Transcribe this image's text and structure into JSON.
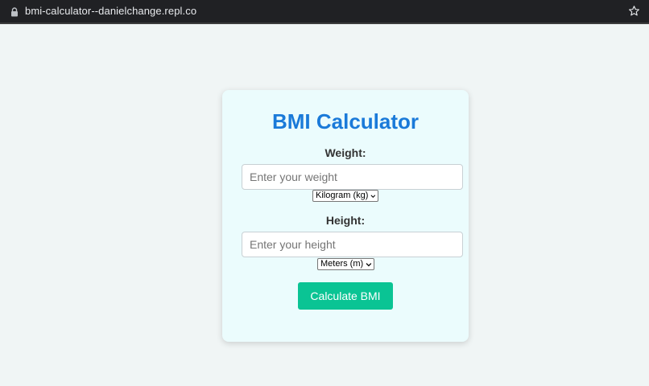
{
  "browser": {
    "url": "bmi-calculator--danielchange.repl.co"
  },
  "calculator": {
    "title": "BMI Calculator",
    "weight": {
      "label": "Weight:",
      "placeholder": "Enter your weight",
      "value": "",
      "unit_selected": "Kilogram (kg)"
    },
    "height": {
      "label": "Height:",
      "placeholder": "Enter your height",
      "value": "",
      "unit_selected": "Meters (m)"
    },
    "button_label": "Calculate BMI"
  },
  "colors": {
    "browser_bar": "#202124",
    "page_bg": "#f0f5f5",
    "card_bg": "#ebfcfd",
    "title": "#1a7ad9",
    "button": "#0ac494"
  },
  "icons": {
    "address_bar_lock": "lock-icon",
    "bookmark": "star-icon",
    "select_chevron": "chevron-down-icon"
  }
}
